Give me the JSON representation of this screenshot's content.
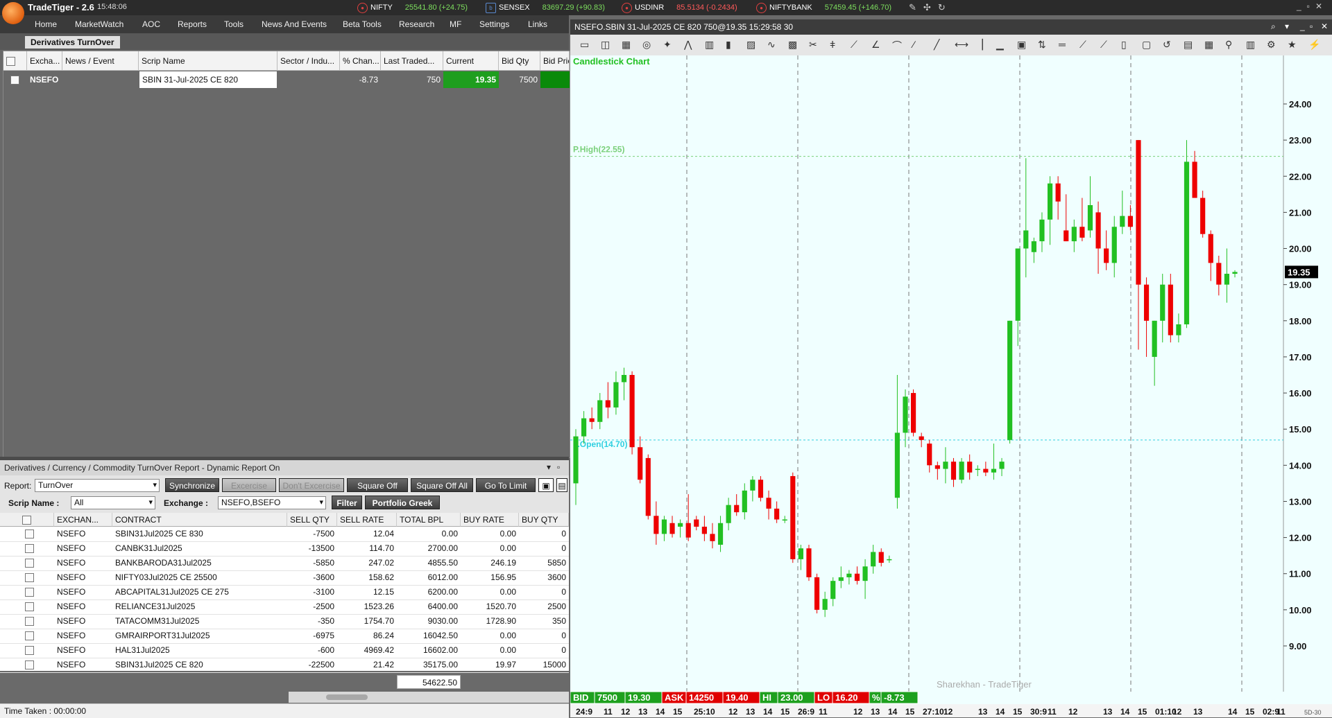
{
  "app": {
    "title": "TradeTiger - 2.6",
    "time": "15:48:06"
  },
  "tickers": [
    {
      "icon": "nse",
      "name": "NIFTY",
      "value": "25541.80 (+24.75)",
      "dir": "up"
    },
    {
      "icon": "bse",
      "name": "SENSEX",
      "value": "83697.29 (+90.83)",
      "dir": "up"
    },
    {
      "icon": "nse",
      "name": "USDINR",
      "value": "85.5134 (-0.2434)",
      "dir": "dn"
    },
    {
      "icon": "nse",
      "name": "NIFTYBANK",
      "value": "57459.45 (+146.70)",
      "dir": "up"
    }
  ],
  "menu": [
    "Home",
    "MarketWatch",
    "AOC",
    "Reports",
    "Tools",
    "News And Events",
    "Beta Tools",
    "Research",
    "MF",
    "Settings",
    "Links"
  ],
  "watch": {
    "tab": "Derivatives TurnOver",
    "columns": [
      "Excha...",
      "News / Event",
      "Scrip Name",
      "Sector / Indu...",
      "% Chan...",
      "Last Traded...",
      "Current",
      "Bid Qty",
      "Bid Pric"
    ],
    "row": {
      "exchange": "NSEFO",
      "news": "",
      "scrip": "SBIN 31-Jul-2025 CE 820",
      "sector": "",
      "pct": "-8.73",
      "ltq": "750",
      "current": "19.35",
      "bidqty": "7500",
      "bidprice": ""
    }
  },
  "report": {
    "title": "Derivatives / Currency / Commodity TurnOver Report - Dynamic Report On",
    "report_label": "Report:",
    "report_value": "TurnOver",
    "scrip_label": "Scrip Name :",
    "scrip_value": "All",
    "exchange_label": "Exchange :",
    "exchange_value": "NSEFO,BSEFO",
    "buttons": {
      "sync": "Synchronize",
      "excercise": "Excercise",
      "dont": "Don't Excercise",
      "sq": "Square Off",
      "sqall": "Square Off All",
      "limit": "Go To Limit",
      "filter": "Filter",
      "greek": "Portfolio Greek"
    },
    "columns": [
      "EXCHAN...",
      "CONTRACT",
      "SELL QTY",
      "SELL RATE",
      "TOTAL BPL",
      "BUY RATE",
      "BUY QTY"
    ],
    "rows": [
      [
        "NSEFO",
        "SBIN31Jul2025 CE 830",
        "-7500",
        "12.04",
        "0.00",
        "0.00",
        "0"
      ],
      [
        "NSEFO",
        "CANBK31Jul2025",
        "-13500",
        "114.70",
        "2700.00",
        "0.00",
        "0"
      ],
      [
        "NSEFO",
        "BANKBARODA31Jul2025",
        "-5850",
        "247.02",
        "4855.50",
        "246.19",
        "5850"
      ],
      [
        "NSEFO",
        "NIFTY03Jul2025 CE 25500",
        "-3600",
        "158.62",
        "6012.00",
        "156.95",
        "3600"
      ],
      [
        "NSEFO",
        "ABCAPITAL31Jul2025 CE 275",
        "-3100",
        "12.15",
        "6200.00",
        "0.00",
        "0"
      ],
      [
        "NSEFO",
        "RELIANCE31Jul2025",
        "-2500",
        "1523.26",
        "6400.00",
        "1520.70",
        "2500"
      ],
      [
        "NSEFO",
        "TATACOMM31Jul2025",
        "-350",
        "1754.70",
        "9030.00",
        "1728.90",
        "350"
      ],
      [
        "NSEFO",
        "GMRAIRPORT31Jul2025",
        "-6975",
        "86.24",
        "16042.50",
        "0.00",
        "0"
      ],
      [
        "NSEFO",
        "HAL31Jul2025",
        "-600",
        "4969.42",
        "16602.00",
        "0.00",
        "0"
      ],
      [
        "NSEFO",
        "SBIN31Jul2025 CE 820",
        "-22500",
        "21.42",
        "35175.00",
        "19.97",
        "15000"
      ]
    ],
    "total": "54622.50",
    "status": "Time Taken : 00:00:00"
  },
  "chart": {
    "window_title": "NSEFO.SBIN 31-Jul-2025 CE 820 750@19.35 15:29:58 30",
    "chart_label": "Candlestick Chart",
    "phigh_label": "P.High(22.55)",
    "popen_label": "P.Open(14.70)",
    "watermark": "Sharekhan - TradeTiger",
    "last_price": "19.35",
    "corner_label": "5D-30",
    "yticks": [
      "24.00",
      "23.00",
      "22.00",
      "21.00",
      "20.00",
      "19.00",
      "18.00",
      "17.00",
      "16.00",
      "15.00",
      "14.00",
      "13.00",
      "12.00",
      "11.00",
      "10.00",
      "9.00"
    ],
    "xticks": [
      "24:9",
      "11",
      "12",
      "13",
      "14",
      "15",
      "25:10",
      "12",
      "13",
      "14",
      "15",
      "26:9",
      "11",
      "12",
      "13",
      "14",
      "15",
      "27:10",
      "12",
      "13",
      "14",
      "15",
      "30:9",
      "11",
      "12",
      "13",
      "14",
      "15",
      "01:10",
      "12",
      "13",
      "14",
      "15",
      "02:9",
      "11"
    ],
    "quote_bar": [
      {
        "label": "BID",
        "value": "7500",
        "value2": "19.30",
        "color": "#1ea01e"
      },
      {
        "label": "ASK",
        "value": "14250",
        "value2": "19.40",
        "color": "#e00000"
      },
      {
        "label": "HI",
        "value": "23.00",
        "color": "#1ea01e"
      },
      {
        "label": "LO",
        "value": "16.20",
        "color": "#e00000"
      },
      {
        "label": "%",
        "value": "-8.73",
        "color": "#1ea01e"
      }
    ],
    "colors": {
      "up": "#22c022",
      "down": "#ee0000",
      "bg": "#f0ffff",
      "phigh": "#7ad07a",
      "popen": "#30d0e0"
    }
  },
  "chart_data": {
    "type": "candlestick",
    "title": "Candlestick Chart",
    "ylim": [
      8.0,
      25.0
    ],
    "reference_lines": [
      {
        "name": "P.High",
        "value": 22.55
      },
      {
        "name": "P.Open",
        "value": 14.7
      }
    ],
    "candles": [
      [
        13.5,
        15.0,
        12.9,
        14.8
      ],
      [
        14.8,
        15.5,
        14.6,
        15.3
      ],
      [
        15.3,
        15.6,
        15.0,
        15.2
      ],
      [
        15.2,
        16.0,
        15.0,
        15.8
      ],
      [
        15.8,
        16.3,
        15.3,
        15.6
      ],
      [
        15.6,
        16.6,
        15.4,
        16.3
      ],
      [
        16.3,
        16.7,
        15.8,
        16.5
      ],
      [
        16.5,
        16.6,
        14.3,
        14.5
      ],
      [
        14.5,
        14.8,
        13.5,
        13.6
      ],
      [
        14.2,
        14.3,
        12.5,
        12.6
      ],
      [
        12.6,
        13.0,
        11.8,
        12.1
      ],
      [
        12.1,
        12.6,
        11.9,
        12.5
      ],
      [
        12.4,
        12.6,
        12.0,
        12.1
      ],
      [
        12.3,
        12.5,
        12.0,
        12.4
      ],
      [
        12.4,
        13.2,
        11.9,
        12.0
      ],
      [
        12.5,
        12.6,
        12.2,
        12.3
      ],
      [
        12.3,
        12.6,
        11.9,
        12.1
      ],
      [
        12.1,
        12.4,
        11.7,
        11.9
      ],
      [
        11.8,
        12.6,
        11.6,
        12.4
      ],
      [
        12.4,
        13.1,
        12.2,
        12.9
      ],
      [
        12.9,
        13.2,
        12.6,
        12.7
      ],
      [
        12.7,
        13.5,
        12.5,
        13.3
      ],
      [
        13.3,
        13.7,
        13.0,
        13.6
      ],
      [
        13.6,
        13.7,
        13.0,
        13.1
      ],
      [
        13.1,
        13.3,
        12.5,
        12.8
      ],
      [
        12.8,
        13.0,
        12.4,
        12.5
      ],
      [
        12.5,
        12.6,
        12.4,
        12.5
      ],
      [
        13.7,
        13.8,
        11.3,
        11.4
      ],
      [
        11.4,
        11.8,
        11.1,
        11.7
      ],
      [
        11.7,
        11.8,
        10.8,
        10.9
      ],
      [
        10.9,
        11.0,
        9.9,
        10.0
      ],
      [
        10.0,
        10.5,
        9.8,
        10.3
      ],
      [
        10.3,
        10.9,
        10.1,
        10.8
      ],
      [
        10.8,
        11.2,
        10.6,
        10.9
      ],
      [
        10.9,
        11.1,
        10.7,
        11.0
      ],
      [
        11.0,
        11.2,
        10.7,
        10.8
      ],
      [
        10.8,
        11.4,
        10.3,
        11.2
      ],
      [
        11.2,
        11.8,
        11.0,
        11.6
      ],
      [
        11.6,
        11.7,
        11.2,
        11.3
      ],
      [
        11.4,
        11.5,
        11.3,
        11.4
      ],
      [
        13.1,
        16.5,
        12.8,
        14.9
      ],
      [
        14.9,
        16.1,
        14.5,
        15.9
      ],
      [
        16.0,
        16.1,
        14.8,
        14.9
      ],
      [
        14.8,
        14.9,
        14.5,
        14.7
      ],
      [
        14.6,
        14.7,
        13.8,
        14.0
      ],
      [
        14.0,
        14.1,
        13.6,
        13.9
      ],
      [
        13.9,
        14.5,
        13.5,
        14.1
      ],
      [
        14.1,
        14.2,
        13.4,
        13.6
      ],
      [
        13.6,
        14.2,
        13.5,
        14.1
      ],
      [
        14.1,
        14.3,
        13.6,
        13.8
      ],
      [
        13.9,
        14.0,
        13.7,
        13.9
      ],
      [
        13.9,
        14.1,
        13.7,
        13.8
      ],
      [
        13.8,
        14.6,
        13.6,
        13.9
      ],
      [
        13.9,
        14.2,
        13.7,
        14.1
      ],
      [
        14.7,
        18.0,
        14.6,
        18.0
      ],
      [
        18.0,
        20.0,
        17.3,
        20.0
      ],
      [
        20.0,
        22.5,
        19.2,
        20.5
      ],
      [
        19.9,
        20.3,
        19.6,
        20.2
      ],
      [
        20.2,
        21.0,
        19.9,
        20.8
      ],
      [
        20.8,
        22.0,
        20.1,
        21.8
      ],
      [
        21.8,
        22.0,
        20.8,
        21.3
      ],
      [
        20.5,
        21.5,
        20.2,
        20.2
      ],
      [
        20.2,
        20.8,
        19.9,
        20.6
      ],
      [
        20.6,
        21.4,
        20.2,
        20.3
      ],
      [
        20.5,
        22.0,
        20.3,
        21.2
      ],
      [
        21.0,
        21.3,
        19.3,
        20.0
      ],
      [
        20.0,
        20.5,
        19.4,
        19.6
      ],
      [
        19.6,
        20.9,
        19.2,
        20.6
      ],
      [
        20.6,
        21.6,
        20.4,
        20.9
      ],
      [
        20.9,
        21.2,
        20.5,
        20.6
      ],
      [
        23.0,
        23.0,
        17.2,
        19.0
      ],
      [
        19.0,
        19.2,
        17.0,
        18.0
      ],
      [
        17.0,
        18.0,
        16.2,
        18.0
      ],
      [
        18.0,
        19.3,
        17.4,
        19.0
      ],
      [
        19.0,
        19.3,
        17.4,
        17.6
      ],
      [
        17.6,
        18.2,
        17.4,
        17.9
      ],
      [
        17.9,
        23.0,
        17.8,
        22.4
      ],
      [
        22.4,
        22.7,
        21.4,
        21.4
      ],
      [
        21.4,
        21.6,
        20.3,
        20.4
      ],
      [
        20.4,
        20.5,
        19.1,
        19.6
      ],
      [
        19.6,
        19.8,
        18.7,
        19.0
      ],
      [
        19.0,
        20.0,
        18.5,
        19.3
      ],
      [
        19.3,
        19.4,
        19.2,
        19.35
      ]
    ]
  }
}
